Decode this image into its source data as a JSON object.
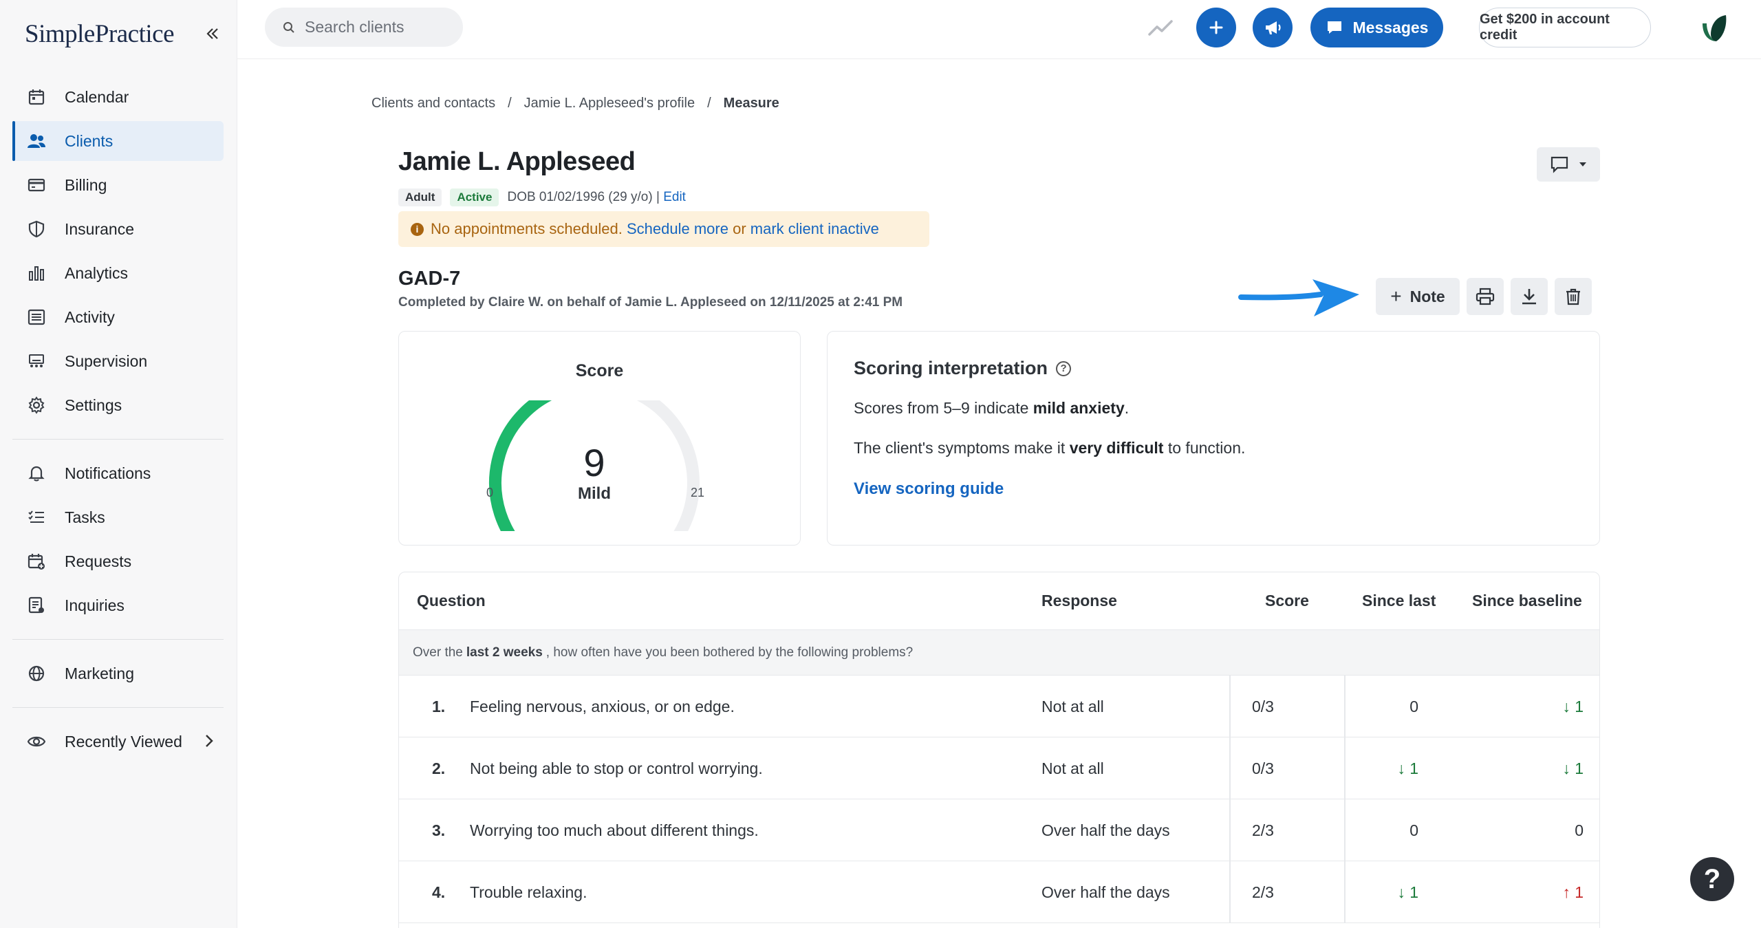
{
  "app": {
    "logo_text": "SimplePractice",
    "colors": {
      "primary": "#1565c0",
      "active_bg": "#e6eef8",
      "alert_bg": "#fdf1dc",
      "alert_text": "#a86410",
      "gauge_fill": "#1db86b",
      "down": "#1b7a3a",
      "up": "#c62828"
    }
  },
  "sidebar": {
    "collapse_icon": "double-chevron-left-icon",
    "items": [
      {
        "label": "Calendar",
        "icon": "calendar-icon",
        "active": false
      },
      {
        "label": "Clients",
        "icon": "users-icon",
        "active": true
      },
      {
        "label": "Billing",
        "icon": "credit-card-icon",
        "active": false
      },
      {
        "label": "Insurance",
        "icon": "shield-icon",
        "active": false
      },
      {
        "label": "Analytics",
        "icon": "bar-chart-icon",
        "active": false
      },
      {
        "label": "Activity",
        "icon": "list-icon",
        "active": false
      },
      {
        "label": "Supervision",
        "icon": "supervision-icon",
        "active": false
      },
      {
        "label": "Settings",
        "icon": "gear-icon",
        "active": false
      }
    ],
    "items2": [
      {
        "label": "Notifications",
        "icon": "bell-icon"
      },
      {
        "label": "Tasks",
        "icon": "checklist-icon"
      },
      {
        "label": "Requests",
        "icon": "calendar-plus-icon"
      },
      {
        "label": "Inquiries",
        "icon": "inquiry-icon"
      }
    ],
    "items3": [
      {
        "label": "Marketing",
        "icon": "globe-icon"
      }
    ],
    "recently_viewed": "Recently Viewed"
  },
  "topbar": {
    "search_placeholder": "Search clients",
    "messages_label": "Messages",
    "credit_label": "Get $200 in account credit"
  },
  "breadcrumb": {
    "items": [
      "Clients and contacts",
      "Jamie L. Appleseed's profile",
      "Measure"
    ]
  },
  "client": {
    "name": "Jamie L. Appleseed",
    "badge_type": "Adult",
    "badge_status": "Active",
    "dob": "DOB 01/02/1996 (29 y/o) |",
    "edit": "Edit",
    "alert_text": "No appointments scheduled.",
    "alert_link1": "Schedule more",
    "alert_or": "or",
    "alert_link2": "mark client inactive"
  },
  "measure": {
    "title": "GAD-7",
    "completed": "Completed by Claire W. on behalf of Jamie L. Appleseed on 12/11/2025 at 2:41 PM",
    "note_label": "Note",
    "score_heading": "Score",
    "score_value": "9",
    "score_label": "Mild",
    "score_min": "0",
    "score_max": "21",
    "score_value_num": 9,
    "score_max_num": 21
  },
  "interpretation": {
    "title": "Scoring interpretation",
    "line1_pre": "Scores from 5–9 indicate",
    "line1_bold": "mild anxiety",
    "line1_post": ".",
    "line2_pre": "The client's symptoms make it",
    "line2_bold": "very difficult",
    "line2_post": "to function.",
    "guide_link": "View scoring guide"
  },
  "table": {
    "headers": {
      "question": "Question",
      "response": "Response",
      "score": "Score",
      "since_last": "Since last",
      "since_baseline": "Since baseline"
    },
    "instr_pre": "Over the",
    "instr_bold": "last 2 weeks",
    "instr_post": ", how often have you been bothered by the following problems?",
    "rows": [
      {
        "num": "1.",
        "question": "Feeling nervous, anxious, or on edge.",
        "response": "Not at all",
        "score": "0/3",
        "since_last": "0",
        "since_last_dir": "none",
        "since_baseline": "↓ 1",
        "since_baseline_dir": "down"
      },
      {
        "num": "2.",
        "question": "Not being able to stop or control worrying.",
        "response": "Not at all",
        "score": "0/3",
        "since_last": "↓ 1",
        "since_last_dir": "down",
        "since_baseline": "↓ 1",
        "since_baseline_dir": "down"
      },
      {
        "num": "3.",
        "question": "Worrying too much about different things.",
        "response": "Over half the days",
        "score": "2/3",
        "since_last": "0",
        "since_last_dir": "none",
        "since_baseline": "0",
        "since_baseline_dir": "none"
      },
      {
        "num": "4.",
        "question": "Trouble relaxing.",
        "response": "Over half the days",
        "score": "2/3",
        "since_last": "↓ 1",
        "since_last_dir": "down",
        "since_baseline": "↑ 1",
        "since_baseline_dir": "up"
      }
    ]
  },
  "help_label": "?"
}
